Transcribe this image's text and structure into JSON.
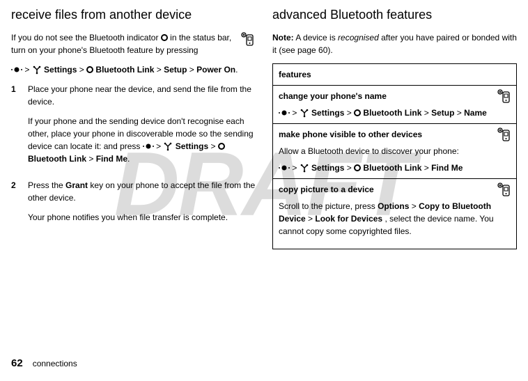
{
  "watermark": "DRAFT",
  "left": {
    "heading": "receive files from another device",
    "intro1a": "If you do not see the Bluetooth indicator ",
    "intro1b": " in the status bar, turn on your phone's Bluetooth feature by pressing",
    "pathA_settings": "Settings",
    "pathA_bt": "Bluetooth Link",
    "pathA_setup": "Setup",
    "pathA_power": "Power On",
    "step1_num": "1",
    "step1_a": "Place your phone near the device, and send the file from the device.",
    "step1_b": "If your phone and the sending device don't recognise each other, place your phone in discoverable mode so the sending device can locate it: and press ",
    "step1_findme": "Find Me",
    "step2_num": "2",
    "step2_a1": "Press the ",
    "step2_grant": "Grant",
    "step2_a2": " key on your phone to accept the file from the other device.",
    "step2_b": "Your phone notifies you when file transfer is complete."
  },
  "right": {
    "heading": "advanced Bluetooth features",
    "note_label": "Note:",
    "note_a": " A device is ",
    "note_em": "recognised",
    "note_b": " after you have paired or bonded with it (see page 60).",
    "table_head": "features",
    "row1_title": "change your phone's name",
    "row1_settings": "Settings",
    "row1_bt": "Bluetooth Link",
    "row1_setup": "Setup",
    "row1_name": "Name",
    "row2_title": "make phone visible to other devices",
    "row2_desc": "Allow a Bluetooth device to discover your phone:",
    "row2_settings": "Settings",
    "row2_bt": "Bluetooth Link",
    "row2_findme": "Find Me",
    "row3_title": "copy picture to a device",
    "row3_a": "Scroll to the picture, press ",
    "row3_options": "Options",
    "row3_copyto": "Copy to Bluetooth Device",
    "row3_lookfor": "Look for Devices",
    "row3_b": ", select the device name. You cannot copy some copyrighted files."
  },
  "footer": {
    "page_number": "62",
    "section": "connections"
  }
}
